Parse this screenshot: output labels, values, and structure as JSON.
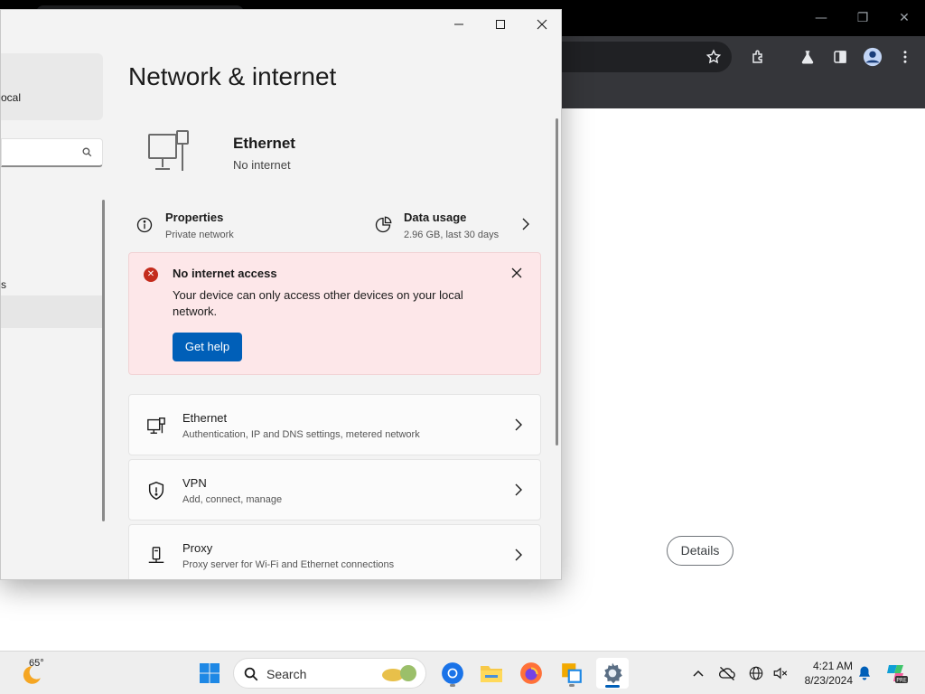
{
  "browser": {
    "details_label": "Details"
  },
  "settings": {
    "user_email_fragment": "ocal",
    "page_title": "Network & internet",
    "connection": {
      "name": "Ethernet",
      "status": "No internet"
    },
    "properties": {
      "title": "Properties",
      "subtitle": "Private network"
    },
    "data_usage": {
      "title": "Data usage",
      "subtitle": "2.96 GB, last 30 days"
    },
    "alert": {
      "title": "No internet access",
      "message": "Your device can only access other devices on your local network.",
      "button_label": "Get help"
    },
    "left_nav": {
      "item_fragment": "s"
    },
    "cards": [
      {
        "icon": "ethernet-icon",
        "title": "Ethernet",
        "subtitle": "Authentication, IP and DNS settings, metered network"
      },
      {
        "icon": "vpn-shield-icon",
        "title": "VPN",
        "subtitle": "Add, connect, manage"
      },
      {
        "icon": "proxy-icon",
        "title": "Proxy",
        "subtitle": "Proxy server for Wi-Fi and Ethernet connections"
      }
    ]
  },
  "taskbar": {
    "weather_temp": "65°",
    "search_label": "Search",
    "time": "4:21 AM",
    "date": "8/23/2024",
    "accent": "#005fb8"
  }
}
